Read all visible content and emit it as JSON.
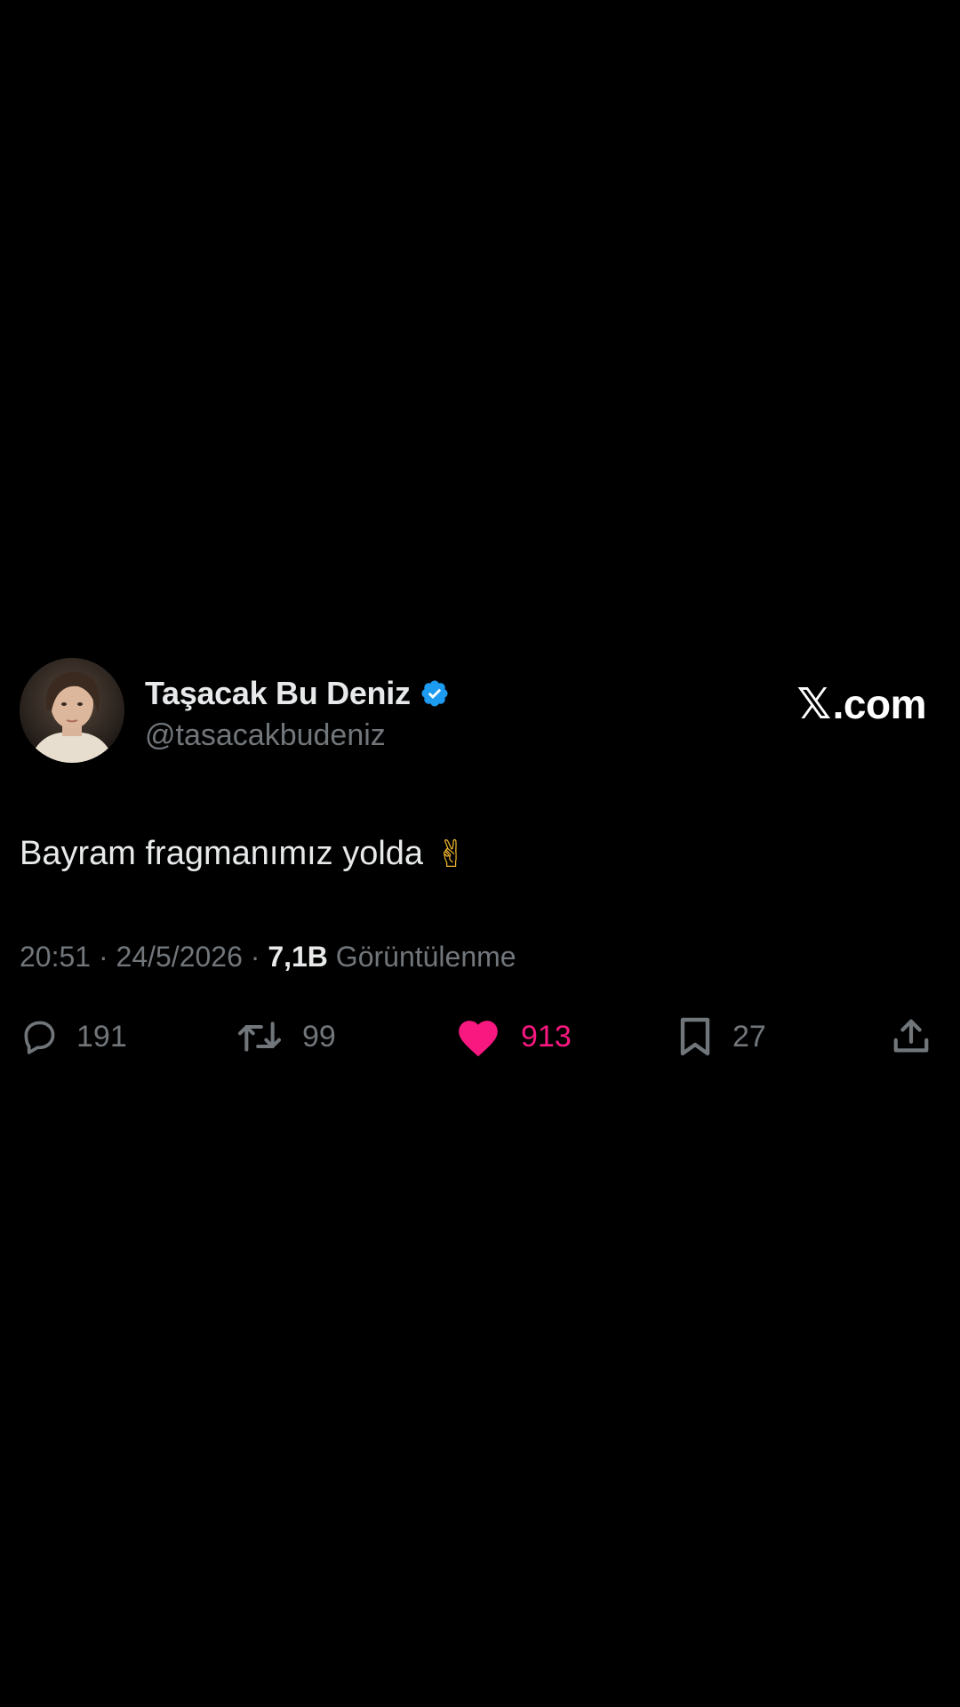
{
  "tweet": {
    "author": {
      "display_name": "Taşacak Bu Deniz",
      "handle": "@tasacakbudeniz",
      "verified": true
    },
    "brand": {
      "x_mark": "𝕏",
      "domain": ".com"
    },
    "text": "Bayram fragmanımız yolda",
    "emoji": "✌",
    "meta": {
      "time": "20:51",
      "separator1": " · ",
      "date": "24/5/2026",
      "separator2": " · ",
      "views": "7,1B",
      "views_label": " Görüntülenme"
    },
    "actions": {
      "replies": "191",
      "retweets": "99",
      "likes": "913",
      "bookmarks": "27"
    },
    "icons": {
      "reply": "reply-icon",
      "retweet": "retweet-icon",
      "like": "heart-icon",
      "bookmark": "bookmark-icon",
      "share": "share-icon",
      "verified": "verified-badge-icon"
    },
    "colors": {
      "background": "#000000",
      "primary_text": "#e7e9ea",
      "secondary_text": "#71767b",
      "like": "#f91880",
      "verified": "#1d9bf0"
    }
  }
}
